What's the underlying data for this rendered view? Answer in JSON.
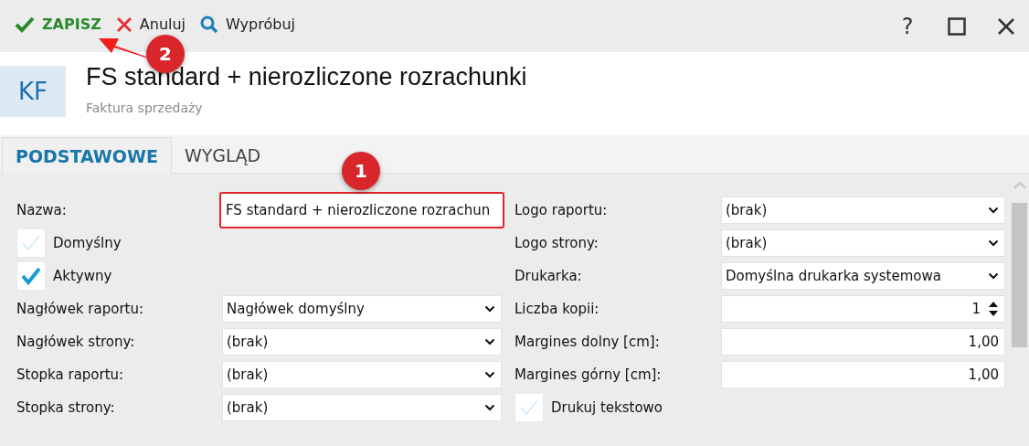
{
  "toolbar": {
    "actions": [
      {
        "kind": "save",
        "label": "ZAPISZ"
      },
      {
        "kind": "cancel",
        "label": "Anuluj"
      },
      {
        "kind": "try",
        "label": "Wypróbuj"
      }
    ],
    "help": "?"
  },
  "header": {
    "badge": "KF",
    "title": "FS standard + nierozliczone rozrachunki",
    "subtitle": "Faktura sprzedaży"
  },
  "tabs": [
    {
      "label": "PODSTAWOWE",
      "selected": true
    },
    {
      "label": "WYGLĄD",
      "selected": false
    }
  ],
  "form": {
    "left": [
      {
        "kind": "text",
        "label": "Nazwa:",
        "value": "FS standard + nierozliczone rozrachun",
        "highlighted": true
      },
      {
        "kind": "checkbox",
        "label": "Domyślny",
        "checked": false
      },
      {
        "kind": "checkbox",
        "label": "Aktywny",
        "checked": true
      },
      {
        "kind": "select",
        "label": "Nagłówek raportu:",
        "value": "Nagłówek domyślny"
      },
      {
        "kind": "select",
        "label": "Nagłówek strony:",
        "value": "(brak)"
      },
      {
        "kind": "select",
        "label": "Stopka raportu:",
        "value": "(brak)"
      },
      {
        "kind": "select",
        "label": "Stopka strony:",
        "value": "(brak)"
      }
    ],
    "right": [
      {
        "kind": "select",
        "label": "Logo raportu:",
        "value": "(brak)"
      },
      {
        "kind": "select",
        "label": "Logo strony:",
        "value": "(brak)"
      },
      {
        "kind": "select",
        "label": "Drukarka:",
        "value": "Domyślna drukarka systemowa"
      },
      {
        "kind": "number",
        "label": "Liczba kopii:",
        "value": "1"
      },
      {
        "kind": "decimal",
        "label": "Margines dolny [cm]:",
        "value": "1,00"
      },
      {
        "kind": "decimal",
        "label": "Margines górny [cm]:",
        "value": "1,00"
      },
      {
        "kind": "checkbox",
        "label": "Drukuj tekstowo",
        "checked": false
      }
    ]
  },
  "annotations": [
    {
      "kind": "badge",
      "text": "1"
    },
    {
      "kind": "badge",
      "text": "2"
    }
  ]
}
